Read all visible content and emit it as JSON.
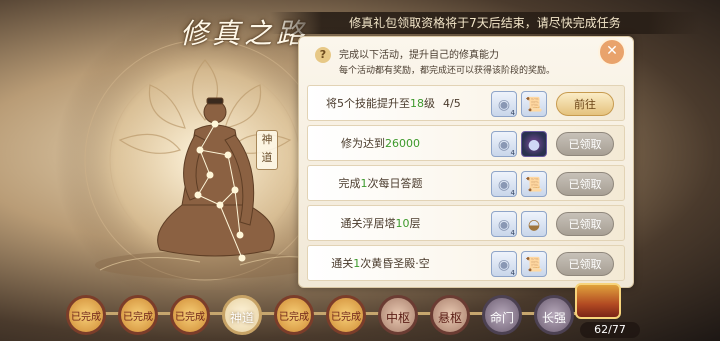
{
  "header": {
    "title": "修真之路",
    "banner": "修真礼包领取资格将于7天后结束，请尽快完成任务"
  },
  "character": {
    "tag": "神道"
  },
  "intro": {
    "line1": "完成以下活动，提升自己的修真能力",
    "line2": "每个活动都有奖励，都完成还可以获得该阶段的奖励。"
  },
  "tasks": [
    {
      "pre": "将5个技能提升至",
      "hl": "18",
      "post": "级",
      "progress": "4/5",
      "r1": "4",
      "r2": "",
      "button": "前往",
      "state": "goto"
    },
    {
      "pre": "修为达到",
      "hl": "26000",
      "post": "",
      "progress": "",
      "r1": "4",
      "r2": "",
      "button": "已领取",
      "state": "claimed"
    },
    {
      "pre": "完成",
      "hl": "1",
      "post": "次每日答题",
      "progress": "",
      "r1": "4",
      "r2": "",
      "button": "已领取",
      "state": "claimed"
    },
    {
      "pre": "通关浮居塔",
      "hl": "10",
      "post": "层",
      "progress": "",
      "r1": "4",
      "r2": "",
      "button": "已领取",
      "state": "claimed"
    },
    {
      "pre": "通关",
      "hl": "1",
      "post": "次黄昏圣殿·空",
      "progress": "",
      "r1": "4",
      "r2": "",
      "button": "已领取",
      "state": "claimed"
    }
  ],
  "icons": {
    "coin": "silver-coin-icon",
    "scroll": "scroll-icon",
    "egg": "spirit-egg-icon",
    "bowl": "food-bowl-icon",
    "close": "close-icon",
    "help": "help-icon",
    "chest": "treasure-chest-icon"
  },
  "stages": [
    {
      "label": "已完成",
      "state": "done"
    },
    {
      "label": "已完成",
      "state": "done"
    },
    {
      "label": "已完成",
      "state": "done"
    },
    {
      "label": "神道",
      "state": "current"
    },
    {
      "label": "已完成",
      "state": "done"
    },
    {
      "label": "已完成",
      "state": "done"
    },
    {
      "label": "中枢",
      "state": "named"
    },
    {
      "label": "悬枢",
      "state": "named"
    },
    {
      "label": "命门",
      "state": "locked"
    },
    {
      "label": "长强",
      "state": "locked"
    }
  ],
  "chest": {
    "count": "62/77"
  },
  "colors": {
    "highlight_green": "#3d9a2c",
    "goto_button": "#e5c27d",
    "claimed_button": "#a79f94",
    "done_stage": "#cf8b35"
  }
}
